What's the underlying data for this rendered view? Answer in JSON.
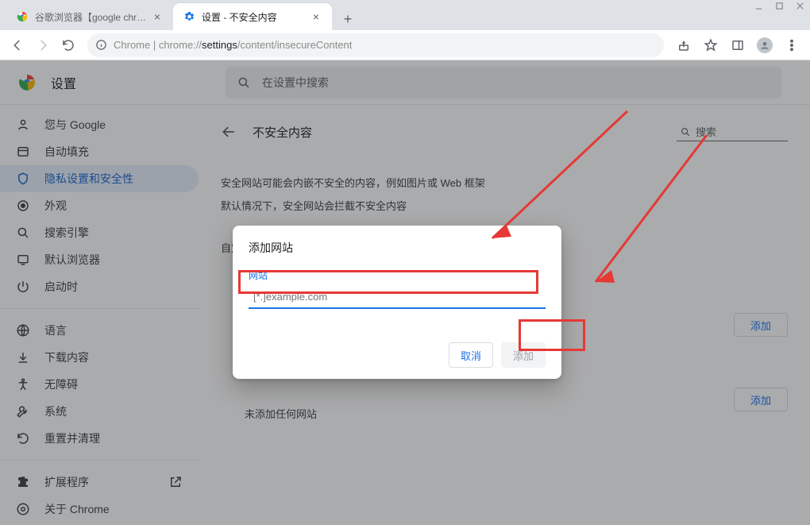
{
  "window": {
    "min": "",
    "max": "",
    "close": ""
  },
  "tabs": [
    {
      "title": "谷歌浏览器【google chrome】"
    },
    {
      "title": "设置 - 不安全内容"
    }
  ],
  "toolbar": {
    "url_prefix": "Chrome",
    "url_sep": " | ",
    "url_host": "chrome://",
    "url_path_em": "settings",
    "url_path_rest": "/content/insecureContent"
  },
  "settings": {
    "heading": "设置",
    "search_placeholder": "在设置中搜索"
  },
  "sidebar": {
    "items": [
      {
        "label": "您与 Google"
      },
      {
        "label": "自动填充"
      },
      {
        "label": "隐私设置和安全性"
      },
      {
        "label": "外观"
      },
      {
        "label": "搜索引擎"
      },
      {
        "label": "默认浏览器"
      },
      {
        "label": "启动时"
      },
      {
        "label": "语言"
      },
      {
        "label": "下载内容"
      },
      {
        "label": "无障碍"
      },
      {
        "label": "系统"
      },
      {
        "label": "重置并清理"
      },
      {
        "label": "扩展程序"
      },
      {
        "label": "关于 Chrome"
      }
    ]
  },
  "page": {
    "title": "不安全内容",
    "search": "搜索",
    "intro1": "安全网站可能会内嵌不安全的内容，例如图片或 Web 框架",
    "intro2": "默认情况下，安全网站会拦截不安全内容",
    "custom": "自定义的行为",
    "add": "添加",
    "empty": "未添加任何网站"
  },
  "dialog": {
    "title": "添加网站",
    "field_label": "网站",
    "placeholder": "[*.]example.com",
    "cancel": "取消",
    "confirm": "添加"
  }
}
